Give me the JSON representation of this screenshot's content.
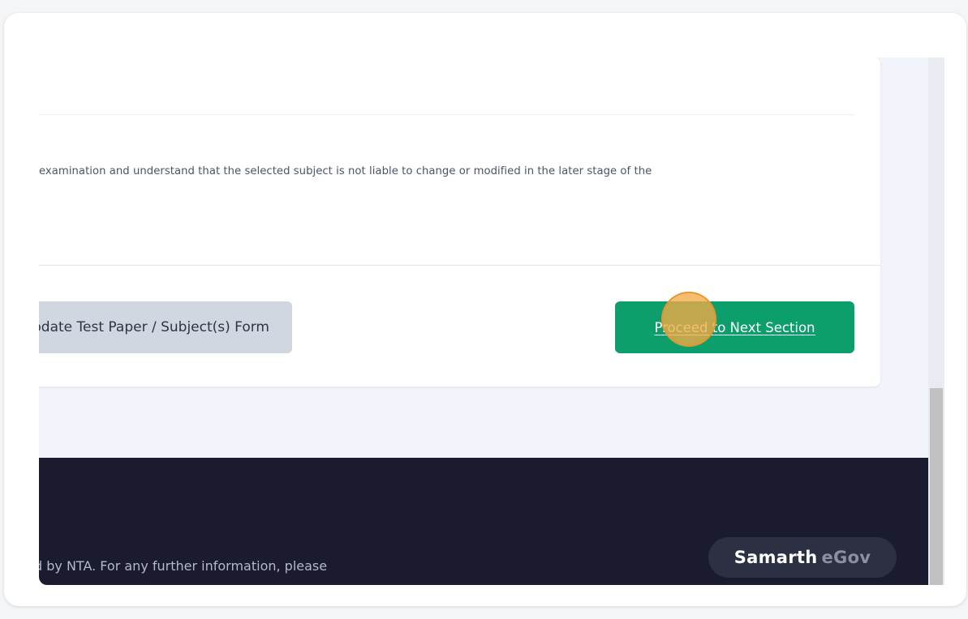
{
  "form": {
    "declaration_text": "examination and understand that the selected subject is not liable to change or modified in the later stage of the"
  },
  "actions": {
    "update_label": "Update Test Paper / Subject(s) Form",
    "proceed_label": "Proceed to Next Section"
  },
  "footer": {
    "info_text": "d by NTA. For any further information, please",
    "brand_primary": "Samarth",
    "brand_secondary": "eGov"
  },
  "colors": {
    "primary_green": "#0c9f6c",
    "footer_bg": "#1a1b2e",
    "secondary_button": "#d1d7e0"
  }
}
